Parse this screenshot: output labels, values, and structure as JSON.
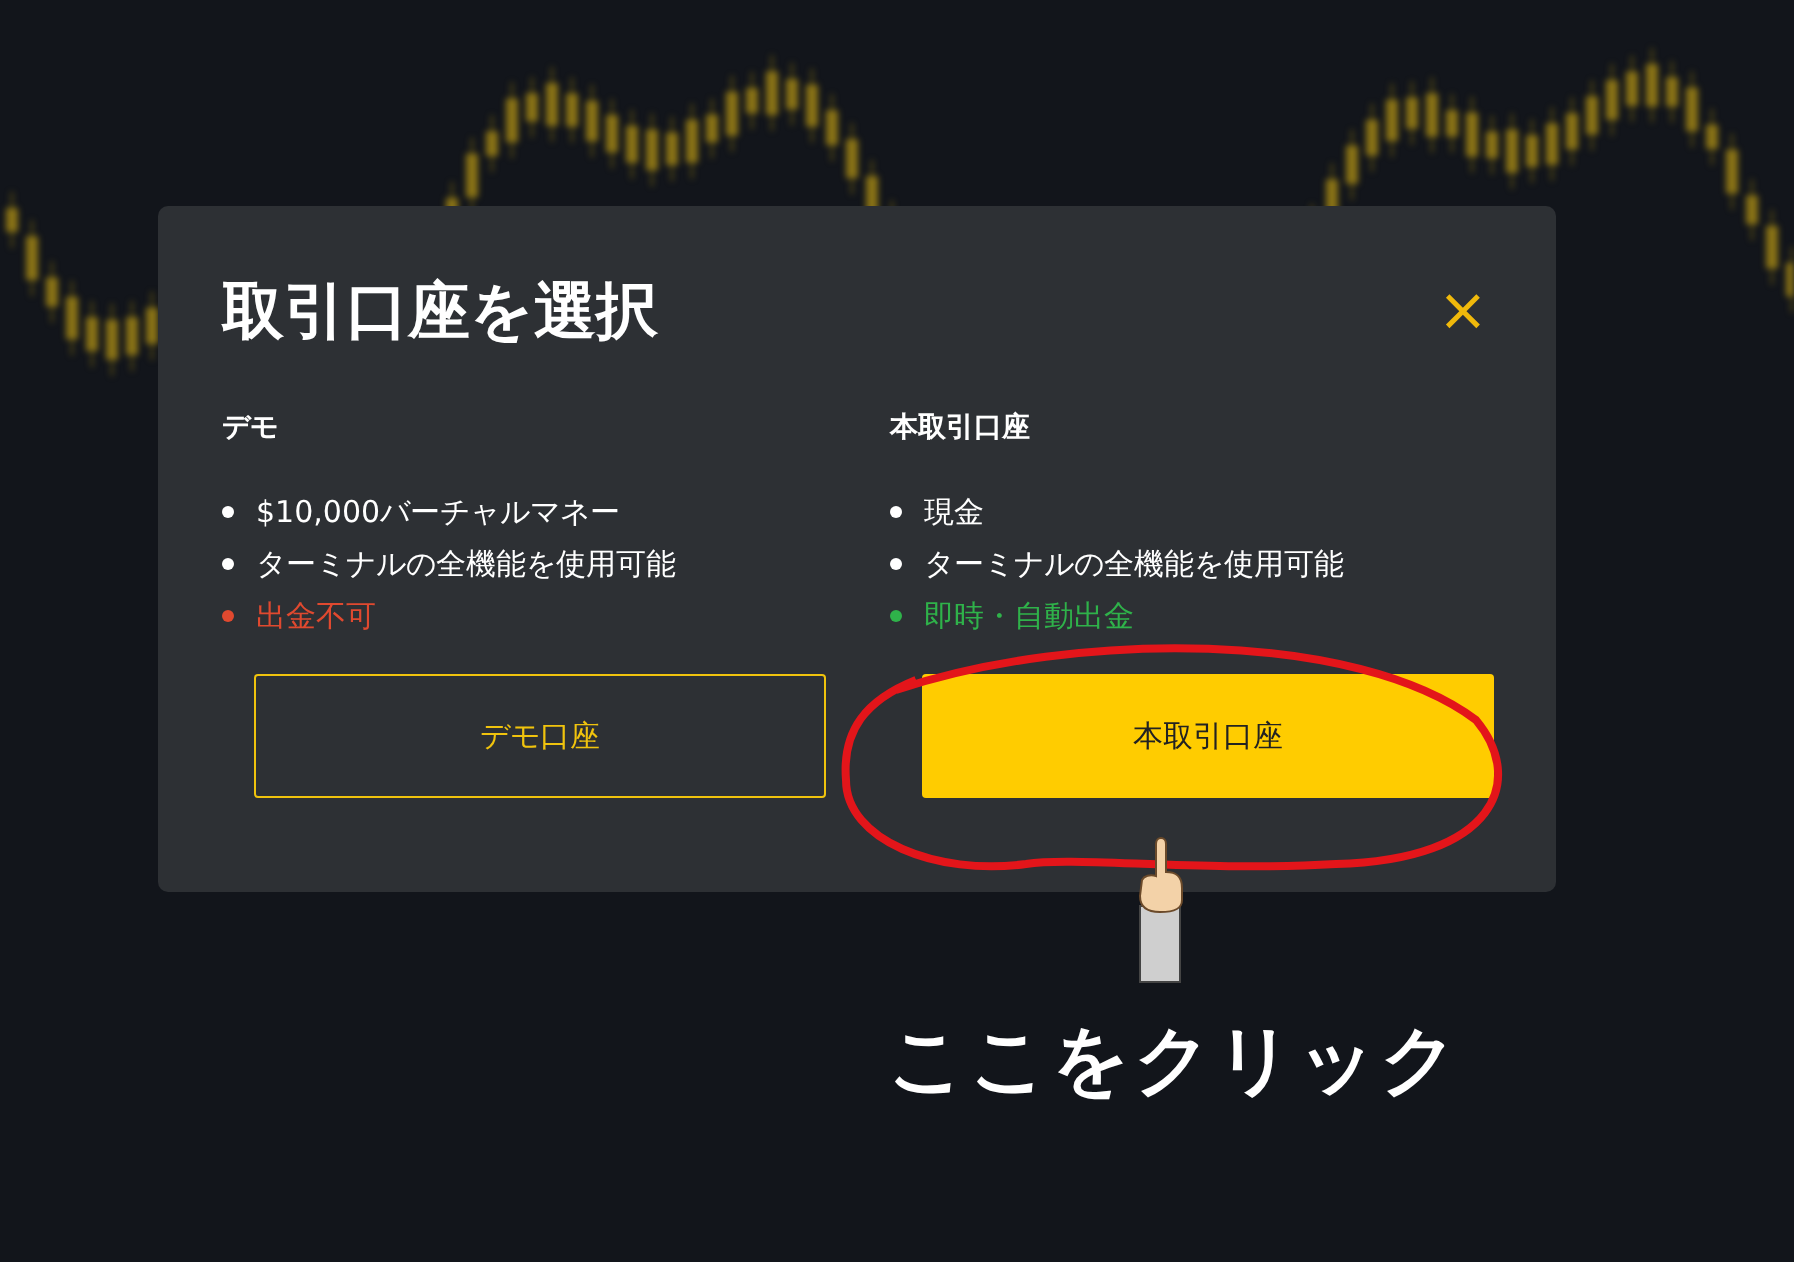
{
  "dialog": {
    "title": "取引口座を選択",
    "close": "×",
    "columns": [
      {
        "heading": "デモ",
        "features": [
          {
            "text": "$10,000バーチャルマネー",
            "kind": "normal"
          },
          {
            "text": "ターミナルの全機能を使用可能",
            "kind": "normal"
          },
          {
            "text": "出金不可",
            "kind": "negative"
          }
        ],
        "button": {
          "label": "デモ口座",
          "kind": "outline"
        }
      },
      {
        "heading": "本取引口座",
        "features": [
          {
            "text": "現金",
            "kind": "normal"
          },
          {
            "text": "ターミナルの全機能を使用可能",
            "kind": "normal"
          },
          {
            "text": "即時・自動出金",
            "kind": "positive"
          }
        ],
        "button": {
          "label": "本取引口座",
          "kind": "primary"
        }
      }
    ]
  },
  "annotation": {
    "caption": "ここをクリック"
  }
}
